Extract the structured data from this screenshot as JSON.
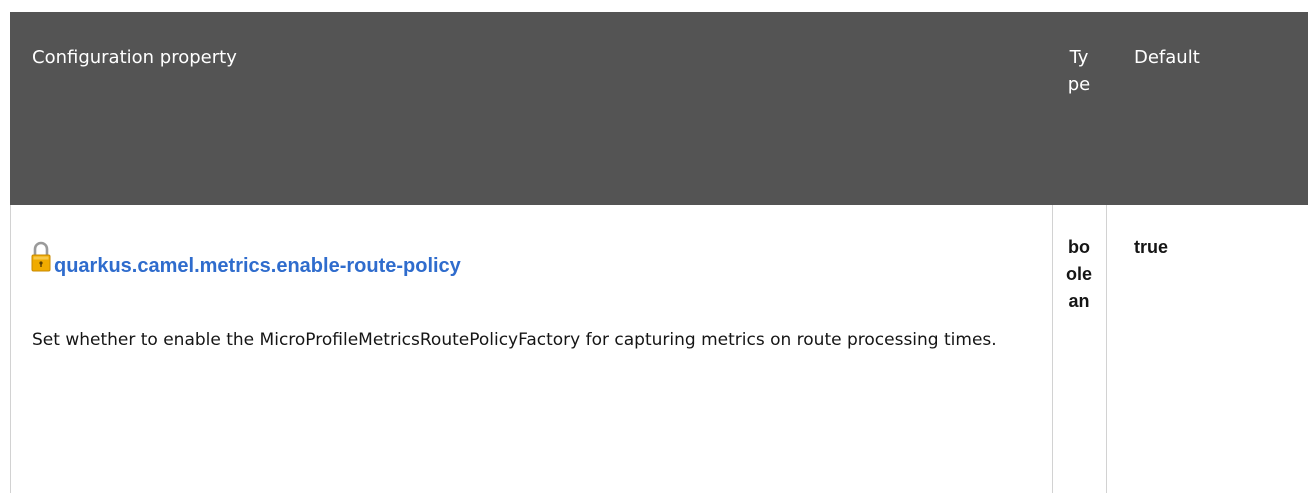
{
  "table": {
    "headers": {
      "property": "Configuration property",
      "type": "Type",
      "default": "Default"
    },
    "rows": [
      {
        "icon": "lock-icon",
        "property": "quarkus.camel.metrics.enable-route-policy",
        "description": "Set whether to enable the MicroProfileMetricsRoutePolicyFactory for capturing metrics on route processing times.",
        "type": "boolean",
        "default": "true"
      }
    ]
  },
  "colors": {
    "header_bg": "#545454",
    "header_text": "#ffffff",
    "link": "#2f6ccd",
    "body_text": "#151515",
    "border": "#d2d2d2",
    "lock": "#f0ab00"
  }
}
